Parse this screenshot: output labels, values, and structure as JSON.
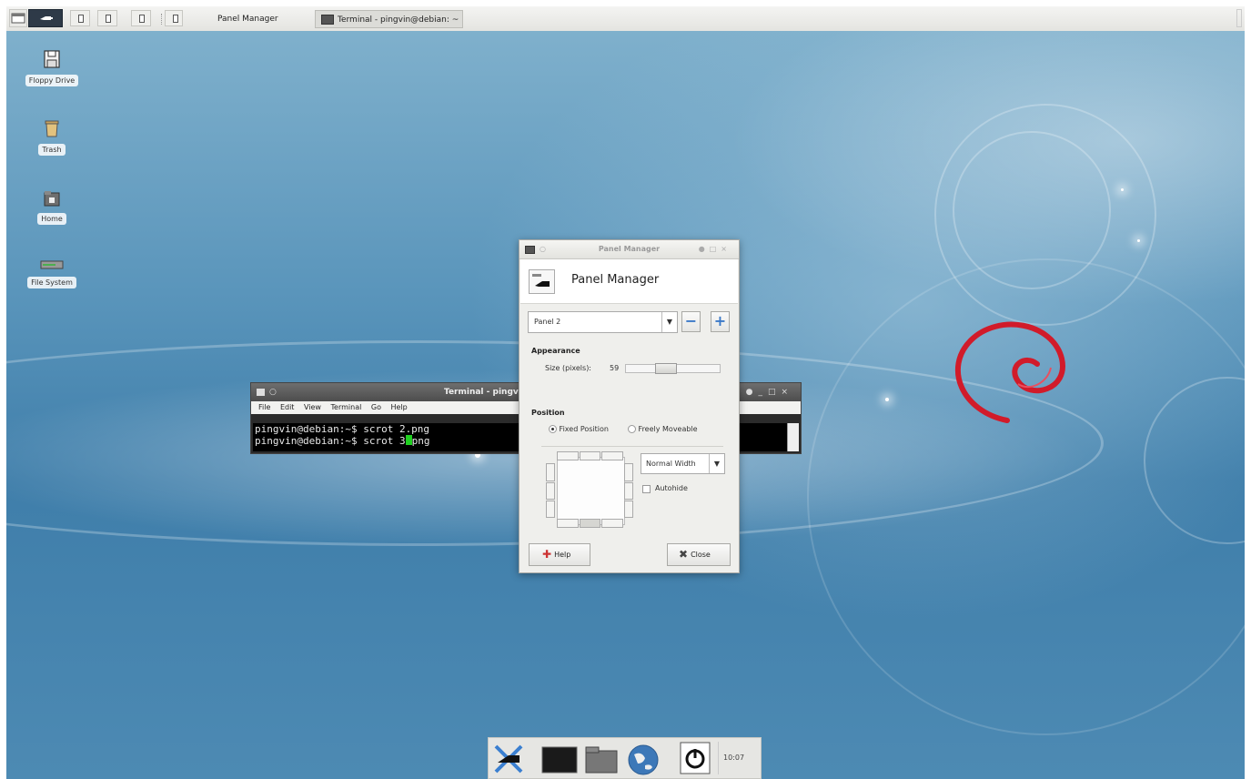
{
  "top_panel": {
    "tasks": [
      {
        "label": "Panel Manager"
      },
      {
        "label": "Terminal - pingvin@debian: ~"
      }
    ]
  },
  "desktop_icons": [
    {
      "label": "Floppy Drive",
      "icon": "floppy-icon"
    },
    {
      "label": "Trash",
      "icon": "trash-icon"
    },
    {
      "label": "Home",
      "icon": "home-folder-icon"
    },
    {
      "label": "File System",
      "icon": "drive-icon"
    }
  ],
  "terminal": {
    "title": "Terminal - pingv",
    "menu": [
      "File",
      "Edit",
      "View",
      "Terminal",
      "Go",
      "Help"
    ],
    "lines": [
      "pingvin@debian:~$ scrot 2.png",
      "pingvin@debian:~$ scrot 3"
    ],
    "line2_after_cursor": "png"
  },
  "panel_manager": {
    "window_title": "Panel Manager",
    "header_title": "Panel Manager",
    "panel_select": "Panel 2",
    "remove_label": "−",
    "add_label": "+",
    "appearance": {
      "title": "Appearance",
      "size_label": "Size (pixels):",
      "size_value": "59",
      "size_fraction": 0.4
    },
    "position": {
      "title": "Position",
      "fixed_label": "Fixed Position",
      "moveable_label": "Freely Moveable",
      "selected": "fixed",
      "width_select": "Normal Width",
      "autohide_label": "Autohide",
      "autohide_checked": false
    },
    "help_label": "Help",
    "close_label": "Close"
  },
  "clock": "10:07",
  "colors": {
    "desktop_blue": "#4d8ab3",
    "swirl_red": "#d11b2a",
    "accent_blue": "#3a78c7",
    "cursor_green": "#20d020"
  }
}
